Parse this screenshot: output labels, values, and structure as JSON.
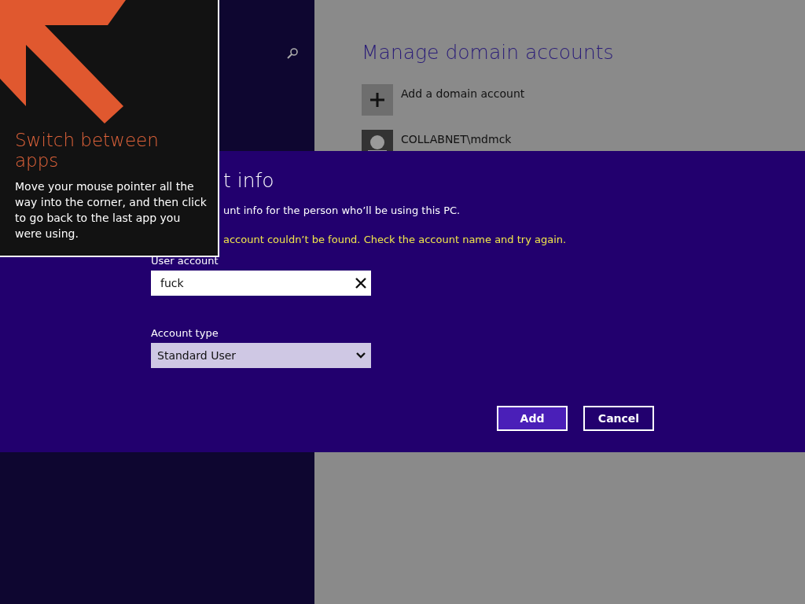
{
  "background": {
    "title": "Manage domain accounts",
    "items": [
      {
        "kind": "add",
        "label": "Add a domain account"
      },
      {
        "kind": "account",
        "label": "COLLABNET\\mdmck"
      }
    ]
  },
  "dialog": {
    "title": "t info",
    "description": "unt info for the person who’ll be using this PC.",
    "error": "account couldn’t be found. Check the account name and try again.",
    "fields": [
      {
        "kind": "text",
        "label": "User account",
        "value": "fuck"
      },
      {
        "kind": "select",
        "label": "Account type",
        "value": "Standard User"
      }
    ],
    "buttons": [
      {
        "label": "Add",
        "primary": true
      },
      {
        "label": "Cancel",
        "primary": false
      }
    ]
  },
  "tip": {
    "title": "Switch between apps",
    "text": "Move your mouse pointer all the way into the corner, and then click to go back to the last app you were using."
  }
}
